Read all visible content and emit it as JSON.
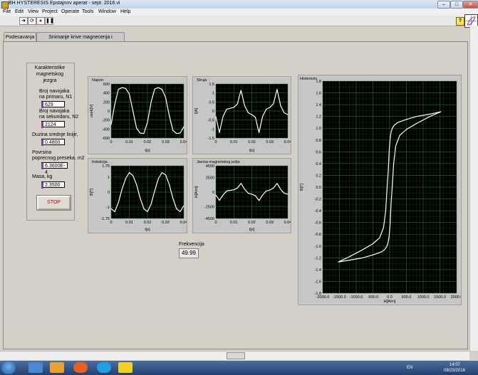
{
  "window": {
    "title": "BH HYSTERESIS Epstajnov aperat - sept. 2016.vi",
    "minimize": "–",
    "maximize": "□",
    "close": "✕"
  },
  "menu": [
    "File",
    "Edit",
    "View",
    "Project",
    "Operate",
    "Tools",
    "Window",
    "Help"
  ],
  "toolbar": {
    "help_label": "?"
  },
  "tabs": [
    {
      "label": "Podesavanja",
      "active": true
    },
    {
      "label": "Snimanje krive magnecenja i histerezisa",
      "active": false
    }
  ],
  "core": {
    "title_line1": "Karakteristike",
    "title_line2": "magnetskog",
    "title_line3": "jezgra",
    "n1_label_1": "Broj navojaka",
    "n1_label_2": "na primaru, N1",
    "n1_value": "629",
    "n2_label_1": "Broj navojaka",
    "n2_label_2": "na sekundaru, N2",
    "n2_value": "2124",
    "length_label": "Duzina srednje linije,",
    "length_value": "0.4800",
    "area_label_1": "Povrsina",
    "area_label_2": "poprecnog preseka, m2",
    "area_value": "6.3600E-4",
    "mass_label": "Masa, kg",
    "mass_value": "2.3500",
    "stop_label": "STOP"
  },
  "frequency": {
    "label": "Frekvencija",
    "value": "49.99"
  },
  "taskbar": {
    "lang": "EN",
    "time": "14:07",
    "date": "09/23/2016"
  },
  "colors": {
    "plot_bg": "#000000",
    "grid": "#2f7a2f",
    "trace": "#ffffff",
    "stop_text": "#c00000"
  },
  "chart_data": [
    {
      "id": "napon",
      "type": "line",
      "title": "Napon",
      "xlabel": "t[s]",
      "ylabel": "usek[V]",
      "xlim": [
        0,
        0.04
      ],
      "ylim": [
        -600,
        600
      ],
      "xticks": [
        "0",
        "0.01",
        "0.02",
        "0.03",
        "0.04"
      ],
      "yticks": [
        "600",
        "400",
        "200",
        "0",
        "-200",
        "-400",
        "-600"
      ],
      "ytick_values": [
        600,
        400,
        200,
        0,
        -200,
        -400,
        -600
      ],
      "x": [
        0,
        0.002,
        0.004,
        0.006,
        0.008,
        0.01,
        0.012,
        0.014,
        0.016,
        0.018,
        0.02,
        0.022,
        0.024,
        0.026,
        0.028,
        0.03,
        0.032,
        0.034,
        0.036,
        0.038,
        0.04
      ],
      "y": [
        -300,
        150,
        480,
        520,
        500,
        380,
        0,
        -380,
        -490,
        -500,
        -250,
        200,
        490,
        520,
        480,
        300,
        -100,
        -430,
        -500,
        -490,
        -350
      ]
    },
    {
      "id": "struja",
      "type": "line",
      "title": "Struja",
      "xlabel": "t[s]",
      "ylabel": "I[A]",
      "xlim": [
        0,
        0.04
      ],
      "ylim": [
        -1.5,
        1.5
      ],
      "xticks": [
        "0",
        "0.01",
        "0.02",
        "0.03",
        "0.04"
      ],
      "yticks": [
        "1.5",
        "1",
        "0.5",
        "0",
        "-0.5",
        "-1",
        "-1.5"
      ],
      "ytick_values": [
        1.5,
        1,
        0.5,
        0,
        -0.5,
        -1,
        -1.5
      ],
      "x": [
        0,
        0.002,
        0.004,
        0.006,
        0.008,
        0.01,
        0.012,
        0.014,
        0.016,
        0.018,
        0.02,
        0.022,
        0.024,
        0.026,
        0.028,
        0.03,
        0.032,
        0.034,
        0.036,
        0.038,
        0.04
      ],
      "y": [
        -0.3,
        -1.2,
        -0.3,
        0.1,
        0.15,
        0.2,
        0.4,
        1.15,
        0.3,
        -0.1,
        -0.2,
        -0.35,
        -1.2,
        -0.3,
        0.1,
        0.2,
        0.4,
        1.2,
        0.3,
        -0.1,
        -0.2
      ]
    },
    {
      "id": "indukcija",
      "type": "line",
      "title": "Indukcija",
      "xlabel": "t[s]",
      "ylabel": "B[T]",
      "xlim": [
        0,
        0.04
      ],
      "ylim": [
        -1.75,
        1.75
      ],
      "xticks": [
        "0",
        "0.01",
        "0.02",
        "0.03",
        "0.04"
      ],
      "yticks": [
        "1.75",
        "1",
        "0",
        "-1",
        "-1.75"
      ],
      "ytick_values": [
        1.75,
        1,
        0,
        -1,
        -1.75
      ],
      "x": [
        0,
        0.002,
        0.004,
        0.006,
        0.008,
        0.01,
        0.012,
        0.014,
        0.016,
        0.018,
        0.02,
        0.022,
        0.024,
        0.026,
        0.028,
        0.03,
        0.032,
        0.034,
        0.036,
        0.038,
        0.04
      ],
      "y": [
        -1.1,
        -1.3,
        -0.7,
        0.2,
        0.9,
        1.3,
        1.1,
        0.5,
        -0.4,
        -1.1,
        -1.3,
        -0.8,
        0.1,
        0.9,
        1.3,
        1.15,
        0.5,
        -0.4,
        -1.1,
        -1.3,
        -0.9
      ]
    },
    {
      "id": "polje",
      "type": "line",
      "title": "Jacina magnetskog polja",
      "xlabel": "t[s]",
      "ylabel": "H[A/m]",
      "xlim": [
        0,
        0.04
      ],
      "ylim": [
        -4500,
        4500
      ],
      "xticks": [
        "0",
        "0.01",
        "0.02",
        "0.03",
        "0.04"
      ],
      "yticks": [
        "4500",
        "2500",
        "0",
        "-2500",
        "-4500"
      ],
      "ytick_values": [
        4500,
        2500,
        0,
        -2500,
        -4500
      ],
      "x": [
        0,
        0.002,
        0.004,
        0.006,
        0.008,
        0.01,
        0.012,
        0.014,
        0.016,
        0.018,
        0.02,
        0.022,
        0.024,
        0.026,
        0.028,
        0.03,
        0.032,
        0.034,
        0.036,
        0.038,
        0.04
      ],
      "y": [
        -500,
        -1400,
        -500,
        200,
        300,
        400,
        700,
        1500,
        500,
        -200,
        -350,
        -600,
        -1450,
        -500,
        200,
        350,
        700,
        1500,
        500,
        -200,
        -350
      ]
    },
    {
      "id": "histerezis",
      "type": "line",
      "title": "Histerezis",
      "xlabel": "H[A/m]",
      "ylabel": "B[T]",
      "xlim": [
        -2000,
        2000
      ],
      "ylim": [
        -1.8,
        1.8
      ],
      "xticks": [
        "-2000.0",
        "-1500.0",
        "-1000.0",
        "-500.0",
        "0.0",
        "500.0",
        "1000.0",
        "1500.0",
        "2000.0"
      ],
      "xtick_values": [
        -2000,
        -1500,
        -1000,
        -500,
        0,
        500,
        1000,
        1500,
        2000
      ],
      "yticks": [
        "1.8",
        "1.6",
        "1.4",
        "1.2",
        "1.0",
        "0.8",
        "0.6",
        "0.4",
        "0.2",
        "0.0",
        "-0.2",
        "-0.4",
        "-0.6",
        "-0.8",
        "-1.0",
        "-1.2",
        "-1.4",
        "-1.6",
        "-1.8"
      ],
      "ytick_values": [
        1.8,
        1.6,
        1.4,
        1.2,
        1.0,
        0.8,
        0.6,
        0.4,
        0.2,
        0.0,
        -0.2,
        -0.4,
        -0.6,
        -0.8,
        -1.0,
        -1.2,
        -1.4,
        -1.6,
        -1.8
      ],
      "x": [
        1530,
        1200,
        800,
        500,
        300,
        180,
        120,
        80,
        40,
        10,
        -20,
        -50,
        -80,
        -110,
        -150,
        -250,
        -500,
        -800,
        -1200,
        -1530,
        -1200,
        -800,
        -500,
        -300,
        -180,
        -120,
        -80,
        -40,
        -10,
        20,
        50,
        80,
        110,
        150,
        250,
        500,
        800,
        1200,
        1530
      ],
      "y": [
        1.28,
        1.2,
        1.08,
        0.98,
        0.88,
        0.7,
        0.4,
        0.05,
        -0.3,
        -0.65,
        -0.85,
        -0.95,
        -1.0,
        -1.03,
        -1.06,
        -1.1,
        -1.15,
        -1.2,
        -1.24,
        -1.27,
        -1.18,
        -1.06,
        -0.96,
        -0.86,
        -0.68,
        -0.4,
        -0.05,
        0.3,
        0.65,
        0.85,
        0.95,
        1.0,
        1.03,
        1.06,
        1.1,
        1.15,
        1.2,
        1.24,
        1.28
      ]
    }
  ]
}
